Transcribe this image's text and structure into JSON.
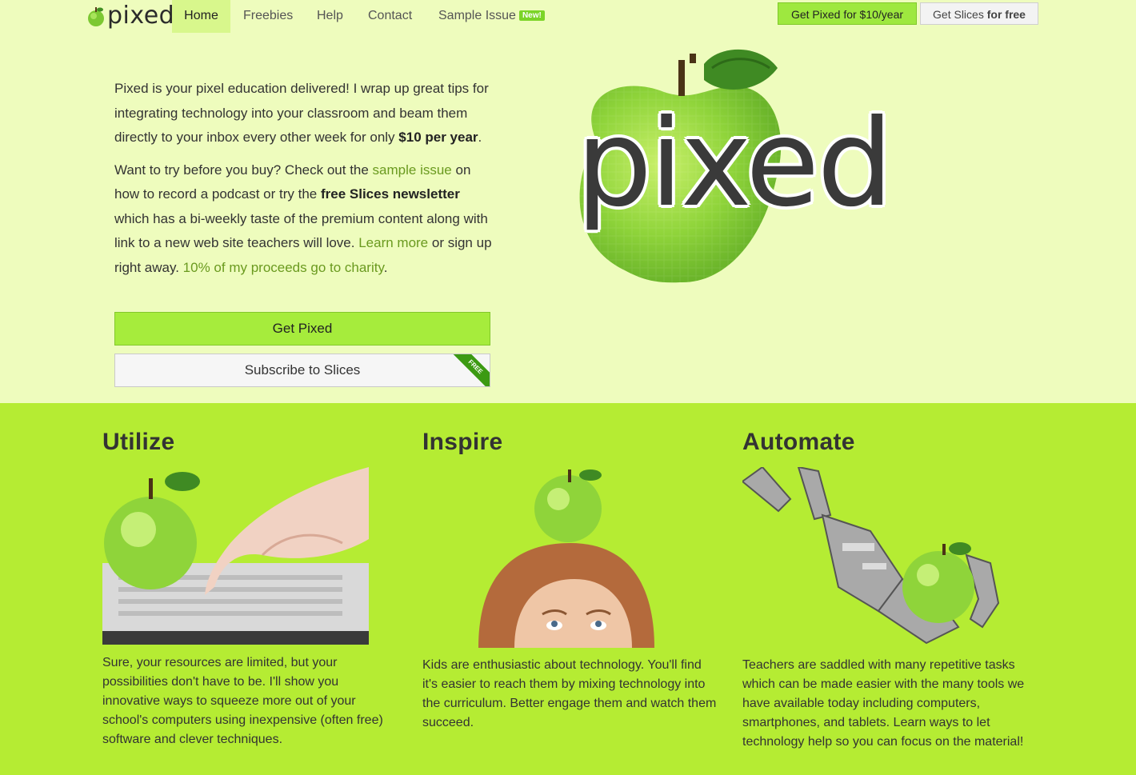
{
  "brand": {
    "name": "pixed"
  },
  "nav": {
    "items": [
      {
        "label": "Home",
        "active": true
      },
      {
        "label": "Freebies",
        "active": false
      },
      {
        "label": "Help",
        "active": false
      },
      {
        "label": "Contact",
        "active": false
      },
      {
        "label": "Sample Issue",
        "active": false,
        "badge": "New!"
      }
    ],
    "buttons": {
      "primary": "Get Pixed for $10/year",
      "secondary_pre": "Get Slices ",
      "secondary_bold": "for free"
    }
  },
  "intro": {
    "p1_pre": "Pixed is your pixel education delivered! I wrap up great tips for integrating technology into your classroom and beam them directly to your inbox every other week for only ",
    "p1_bold": "$10 per year",
    "p1_post": ".",
    "p2_a": "Want to try before you buy? Check out the ",
    "p2_link1": "sample issue",
    "p2_b": " on how to record a podcast or try the ",
    "p2_bold": "free Slices newsletter",
    "p2_c": " which has a bi-weekly taste of the premium content along with link to a new web site teachers will love. ",
    "p2_link2": "Learn more",
    "p2_d": " or sign up right away. ",
    "p2_link3": "10% of my proceeds go to charity",
    "p2_e": "."
  },
  "cta": {
    "primary": "Get Pixed",
    "secondary": "Subscribe to Slices",
    "ribbon": "FREE"
  },
  "hero": {
    "wordmark": "pixed"
  },
  "colors": {
    "page_bg": "#eefcbd",
    "accent": "#a6ec3c",
    "features_bg": "#b5ec33",
    "link": "#6a9a1f"
  },
  "features": [
    {
      "title": "Utilize",
      "description": "Sure, your resources are limited, but your possibilities don't have to be. I'll show you innovative ways to squeeze more out of your school's computers using inexpensive (often free) software and clever techniques.",
      "icon": "apple-keyboard-hand-icon"
    },
    {
      "title": "Inspire",
      "description": "Kids are enthusiastic about technology. You'll find it's easier to reach them by mixing technology into the curriculum. Better engage them and watch them succeed.",
      "icon": "apple-on-head-icon"
    },
    {
      "title": "Automate",
      "description": "Teachers are saddled with many repetitive tasks which can be made easier with the many tools we have available today including computers, smartphones, and tablets. Learn ways to let technology help so you can focus on the material!",
      "icon": "robot-hand-apple-icon"
    }
  ]
}
